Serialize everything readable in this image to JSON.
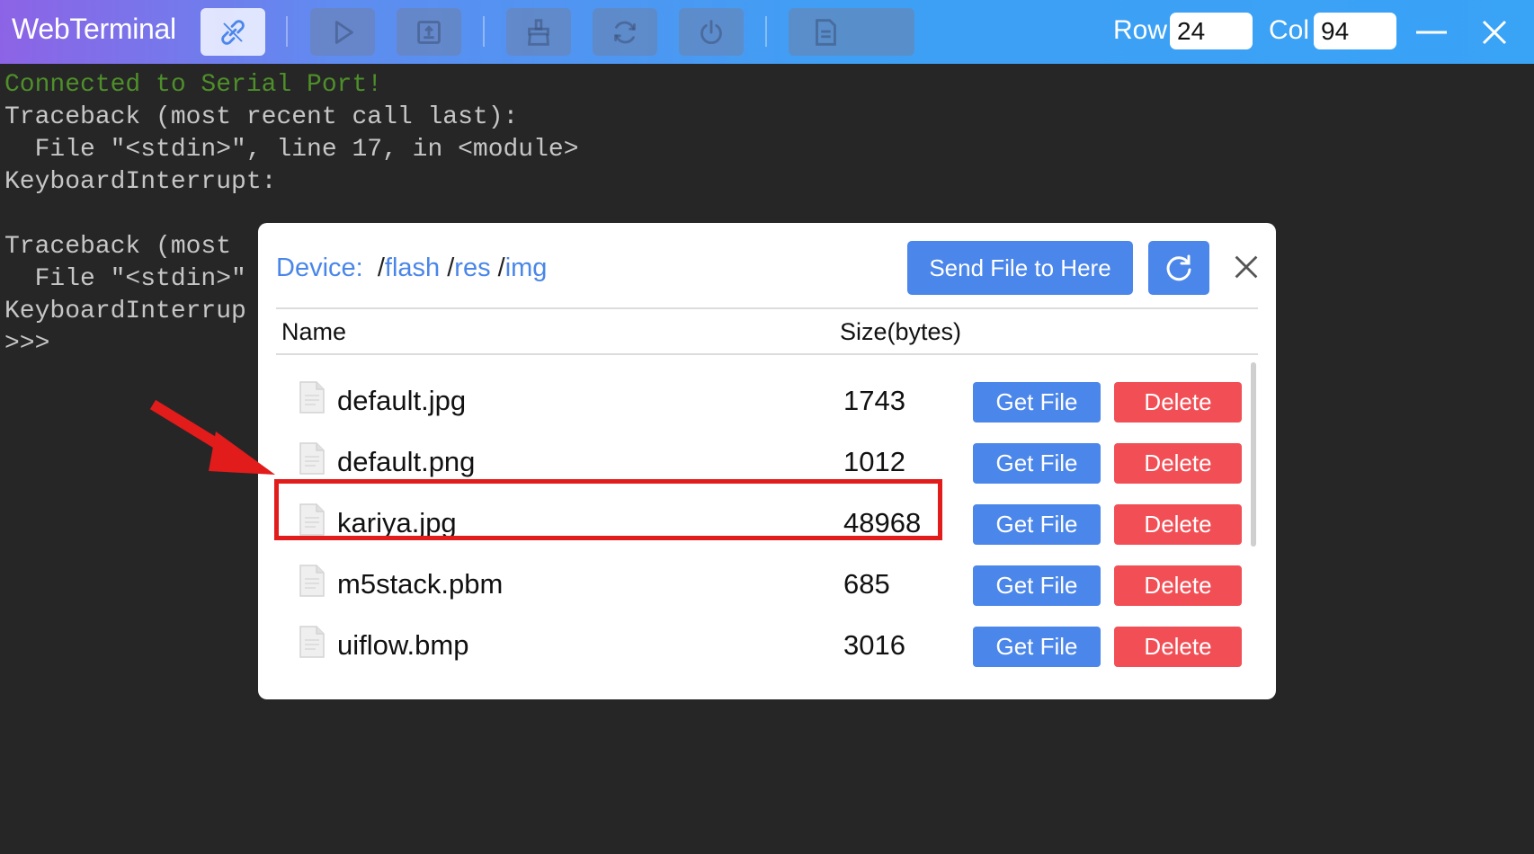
{
  "app": {
    "title": "WebTerminal"
  },
  "toolbar": {
    "row_label": "Row",
    "row_value": "24",
    "col_label": "Col",
    "col_value": "94",
    "buttons": [
      "link-icon",
      "play-icon",
      "save-upload-icon",
      "clear-brush-icon",
      "sync-icon",
      "power-icon",
      "file-icon"
    ]
  },
  "terminal": {
    "lines": [
      "Connected to Serial Port!",
      "Traceback (most recent call last):",
      "  File \"<stdin>\", line 17, in <module>",
      "KeyboardInterrupt:",
      "",
      "Traceback (most",
      "  File \"<stdin>\"",
      "KeyboardInterrup",
      ">>>"
    ]
  },
  "file_dialog": {
    "breadcrumb": {
      "device_label": "Device:",
      "segments": [
        "flash",
        "res",
        "img"
      ]
    },
    "send_button": "Send File to Here",
    "columns": {
      "name": "Name",
      "size": "Size(bytes)"
    },
    "get_label": "Get File",
    "delete_label": "Delete",
    "files": [
      {
        "name": "default.jpg",
        "size": "1743"
      },
      {
        "name": "default.png",
        "size": "1012"
      },
      {
        "name": "kariya.jpg",
        "size": "48968"
      },
      {
        "name": "m5stack.pbm",
        "size": "685"
      },
      {
        "name": "uiflow.bmp",
        "size": "3016"
      }
    ],
    "highlighted_file": "kariya.jpg"
  },
  "colors": {
    "accent_blue": "#4b86ea",
    "danger_red": "#f14f55",
    "annotation_red": "#e21b1b",
    "terminal_green": "#4e8f2a"
  }
}
